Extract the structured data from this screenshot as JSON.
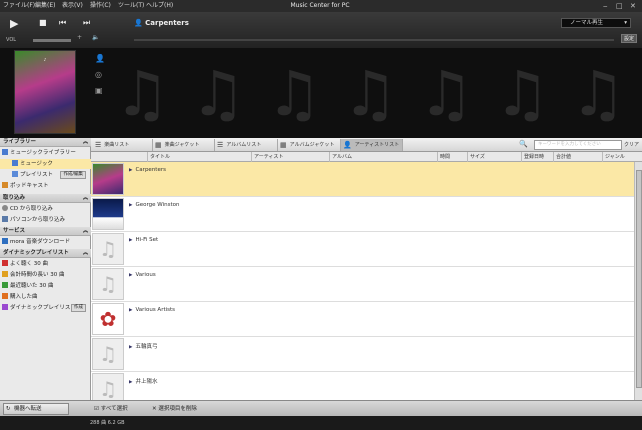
{
  "menu": {
    "items": [
      "ファイル(F)",
      "編集(E)",
      "表示(V)",
      "操作(C)",
      "ツール(T)",
      "ヘルプ(H)"
    ],
    "window_title": "Music Center for PC"
  },
  "player": {
    "user_name": "Carpenters",
    "mode_label": "ノーマル再生",
    "settings_label": "設定",
    "volume_label": "VOL"
  },
  "sidebar": {
    "sections": [
      {
        "title": "ライブラリー",
        "items": [
          "ミュージックライブラリー",
          "ミュージック",
          "プレイリスト",
          "ポッドキャスト"
        ],
        "playlist_btn": "作成/編集"
      },
      {
        "title": "取り込み",
        "items": [
          "CD から取り込み",
          "パソコンから取り込み"
        ]
      },
      {
        "title": "サービス",
        "items": [
          "mora 音楽ダウンロード"
        ]
      },
      {
        "title": "ダイナミックプレイリスト",
        "items": [
          "よく聴く 30 曲",
          "会計時間の長い 30 曲",
          "最近聴いた 30 曲",
          "購入した曲",
          "ダイナミックプレイリスト"
        ],
        "dyn_btn": "作成"
      }
    ],
    "transfer_button": "機器へ転送"
  },
  "toolbar": {
    "tabs": [
      "楽曲リスト",
      "楽曲ジャケット",
      "アルバムリスト",
      "アルバムジャケット",
      "アーティストリスト"
    ],
    "search_placeholder": "キーワードを入力してください",
    "clear_label": "クリア"
  },
  "columns": [
    "タイトル",
    "アーティスト",
    "アルバム",
    "時間",
    "サイズ",
    "登録日時",
    "合計値",
    "ジャンル"
  ],
  "rows": [
    {
      "name": "Carpenters",
      "selected": true
    },
    {
      "name": "George Winston",
      "selected": false
    },
    {
      "name": "Hi-Fi Set",
      "selected": false
    },
    {
      "name": "Various",
      "selected": false
    },
    {
      "name": "Various Artists",
      "selected": false
    },
    {
      "name": "五輪真弓",
      "selected": false
    },
    {
      "name": "井上陽水",
      "selected": false
    }
  ],
  "bottom": {
    "select_all": "すべて選択",
    "delete_selected": "選択項目を削除"
  },
  "status": {
    "text": "288 曲  6.2 GB"
  }
}
